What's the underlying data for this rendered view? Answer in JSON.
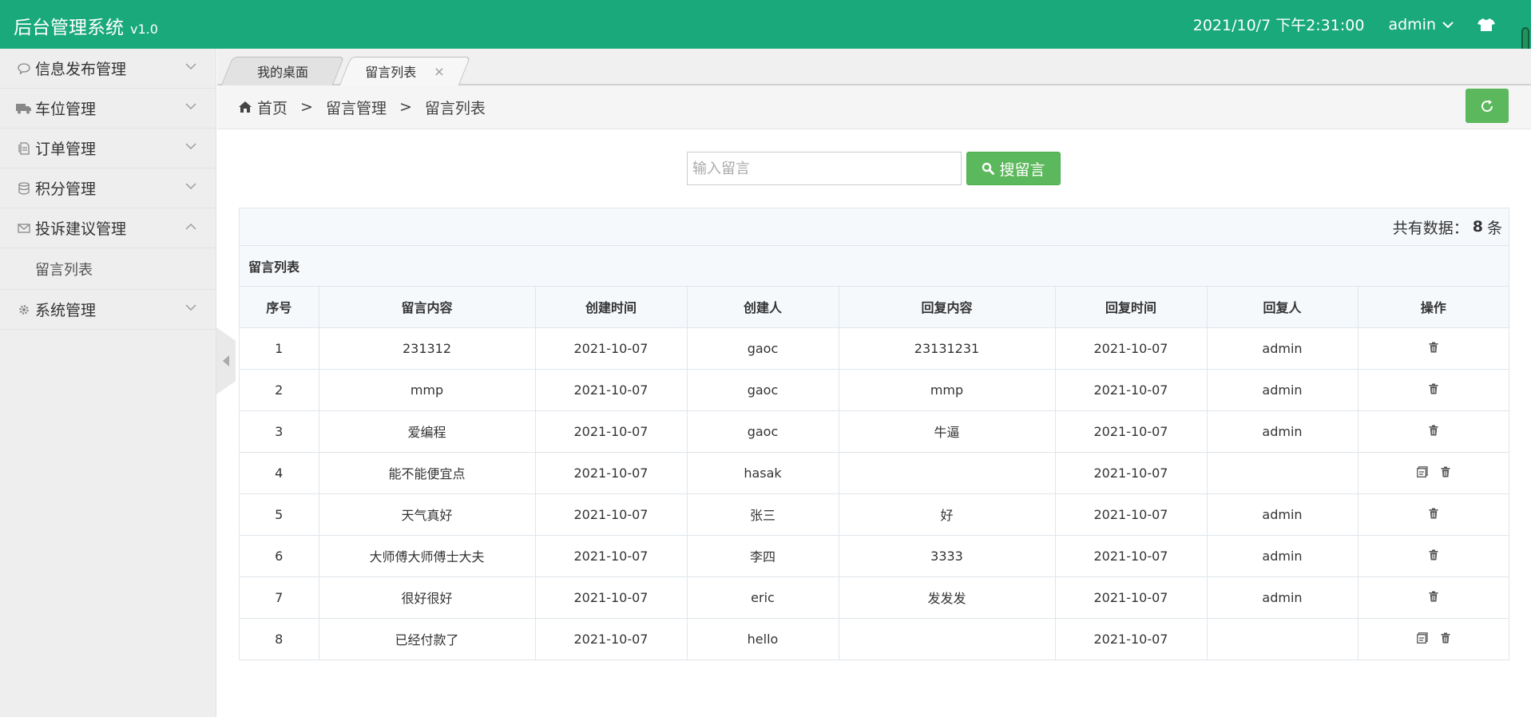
{
  "header": {
    "title": "后台管理系统",
    "version": "v1.0",
    "datetime": "2021/10/7 下午2:31:00",
    "user": "admin",
    "theme_icon": "tshirt-icon"
  },
  "sidebar": {
    "items": [
      {
        "label": "信息发布管理",
        "icon": "comment-icon",
        "expanded": false
      },
      {
        "label": "车位管理",
        "icon": "truck-icon",
        "expanded": false
      },
      {
        "label": "订单管理",
        "icon": "file-icon",
        "expanded": false
      },
      {
        "label": "积分管理",
        "icon": "database-icon",
        "expanded": false
      },
      {
        "label": "投诉建议管理",
        "icon": "envelope-icon",
        "expanded": true
      },
      {
        "label": "系统管理",
        "icon": "gear-icon",
        "expanded": false
      }
    ],
    "sub_items": [
      "留言列表"
    ]
  },
  "tabs": [
    {
      "label": "我的桌面"
    },
    {
      "label": "留言列表",
      "close": "×"
    }
  ],
  "breadcrumb": {
    "items": [
      "首页",
      "留言管理",
      "留言列表"
    ],
    "separator": ">"
  },
  "search": {
    "placeholder": "输入留言",
    "value": "",
    "button_label": "搜留言"
  },
  "table": {
    "count_prefix": "共有数据：",
    "count": "8",
    "count_suffix": "条",
    "title": "留言列表",
    "columns": [
      "序号",
      "留言内容",
      "创建时间",
      "创建人",
      "回复内容",
      "回复时间",
      "回复人",
      "操作"
    ],
    "rows": [
      {
        "id": "1",
        "content": "231312",
        "created": "2021-10-07",
        "creator": "gaoc",
        "reply": "23131231",
        "reply_time": "2021-10-07",
        "replier": "admin",
        "ops": [
          "delete-icon"
        ]
      },
      {
        "id": "2",
        "content": "mmp",
        "created": "2021-10-07",
        "creator": "gaoc",
        "reply": "mmp",
        "reply_time": "2021-10-07",
        "replier": "admin",
        "ops": [
          "delete-icon"
        ]
      },
      {
        "id": "3",
        "content": "爱编程",
        "created": "2021-10-07",
        "creator": "gaoc",
        "reply": "牛逼",
        "reply_time": "2021-10-07",
        "replier": "admin",
        "ops": [
          "delete-icon"
        ]
      },
      {
        "id": "4",
        "content": "能不能便宜点",
        "created": "2021-10-07",
        "creator": "hasak",
        "reply": "",
        "reply_time": "2021-10-07",
        "replier": "",
        "ops": [
          "reply-icon",
          "delete-icon"
        ]
      },
      {
        "id": "5",
        "content": "天气真好",
        "created": "2021-10-07",
        "creator": "张三",
        "reply": "好",
        "reply_time": "2021-10-07",
        "replier": "admin",
        "ops": [
          "delete-icon"
        ]
      },
      {
        "id": "6",
        "content": "大师傅大师傅士大夫",
        "created": "2021-10-07",
        "creator": "李四",
        "reply": "3333",
        "reply_time": "2021-10-07",
        "replier": "admin",
        "ops": [
          "delete-icon"
        ]
      },
      {
        "id": "7",
        "content": "很好很好",
        "created": "2021-10-07",
        "creator": "eric",
        "reply": "发发发",
        "reply_time": "2021-10-07",
        "replier": "admin",
        "ops": [
          "delete-icon"
        ]
      },
      {
        "id": "8",
        "content": "已经付款了",
        "created": "2021-10-07",
        "creator": "hello",
        "reply": "",
        "reply_time": "2021-10-07",
        "replier": "",
        "ops": [
          "reply-icon",
          "delete-icon"
        ]
      }
    ]
  },
  "colors": {
    "header_bg": "#1aa97b",
    "button_green": "#5cb85c",
    "sidebar_bg": "#eeeeee"
  }
}
